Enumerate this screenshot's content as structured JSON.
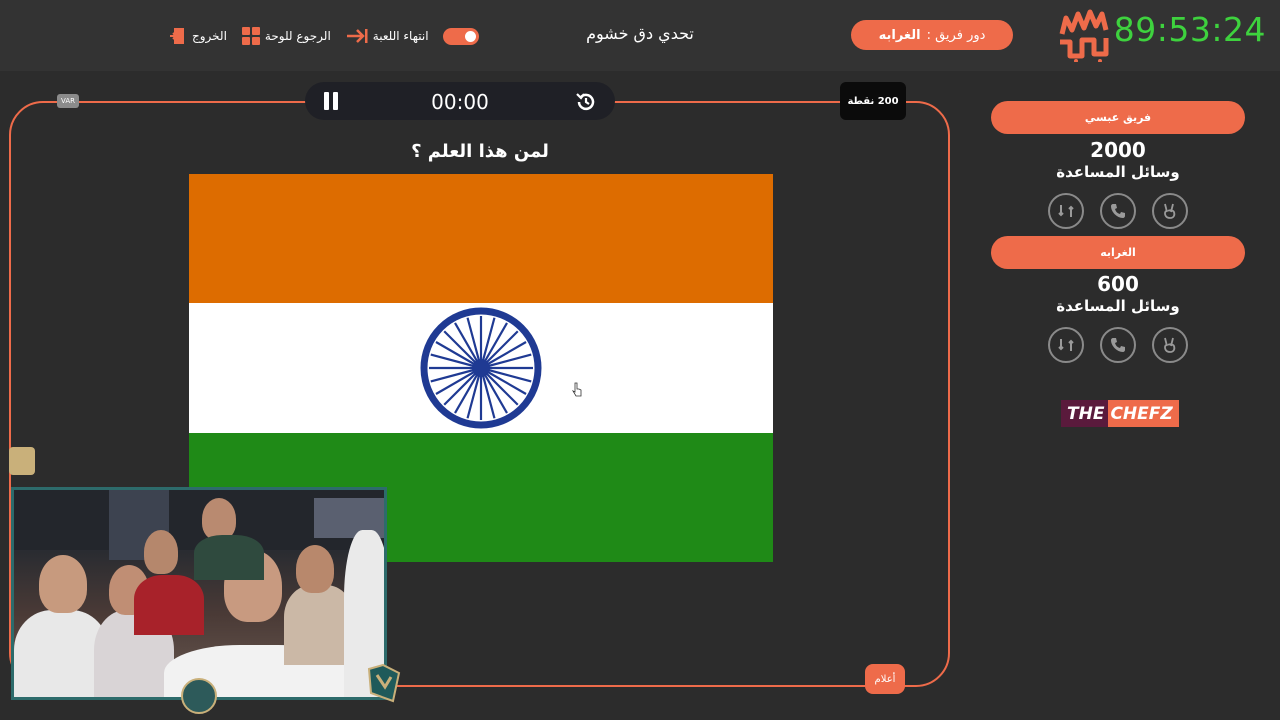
{
  "header": {
    "timer": "89:53:24",
    "logo_text": "سين جيم",
    "turn_label": "دور فريق :",
    "turn_team": "الغرابه",
    "game_title": "تحدي دق خشوم",
    "actions": [
      {
        "label": "انتهاء اللعبة",
        "icon": "toggle-icon"
      },
      {
        "label": "الرجوع للوحة",
        "icon": "arrow-left-icon"
      },
      {
        "label": "الرجوع للوحة",
        "icon": "grid-icon"
      },
      {
        "label": "الخروج",
        "icon": "exit-door-icon"
      }
    ],
    "end_game_label": "انتهاء اللعبة",
    "back_to_board_label": "الرجوع للوحة",
    "exit_label": "الخروج"
  },
  "question_panel": {
    "var_label": "VAR",
    "countdown": "00:00",
    "points": "200 نقطة",
    "question": "لمن هذا العلم ؟",
    "category": "أعلام",
    "flag": {
      "top": "#dd6c00",
      "middle": "#ffffff",
      "bottom": "#1f8a17",
      "chakra": "#1f3a93"
    }
  },
  "teams": [
    {
      "name": "فريق عبسي",
      "score": "2000",
      "aids_label": "وسائل المساعدة",
      "aids": [
        "swap-icon",
        "phone-icon",
        "peace-hand-icon"
      ]
    },
    {
      "name": "الغرابه",
      "score": "600",
      "aids_label": "وسائل المساعدة",
      "aids": [
        "swap-icon",
        "phone-icon",
        "peace-hand-icon"
      ]
    }
  ],
  "sponsor": {
    "part1": "THE",
    "part2": "CHEFZ"
  },
  "colors": {
    "accent": "#ee6b4a",
    "timer": "#3ed23e",
    "background": "#2c2c2c",
    "topbar": "#333333"
  }
}
